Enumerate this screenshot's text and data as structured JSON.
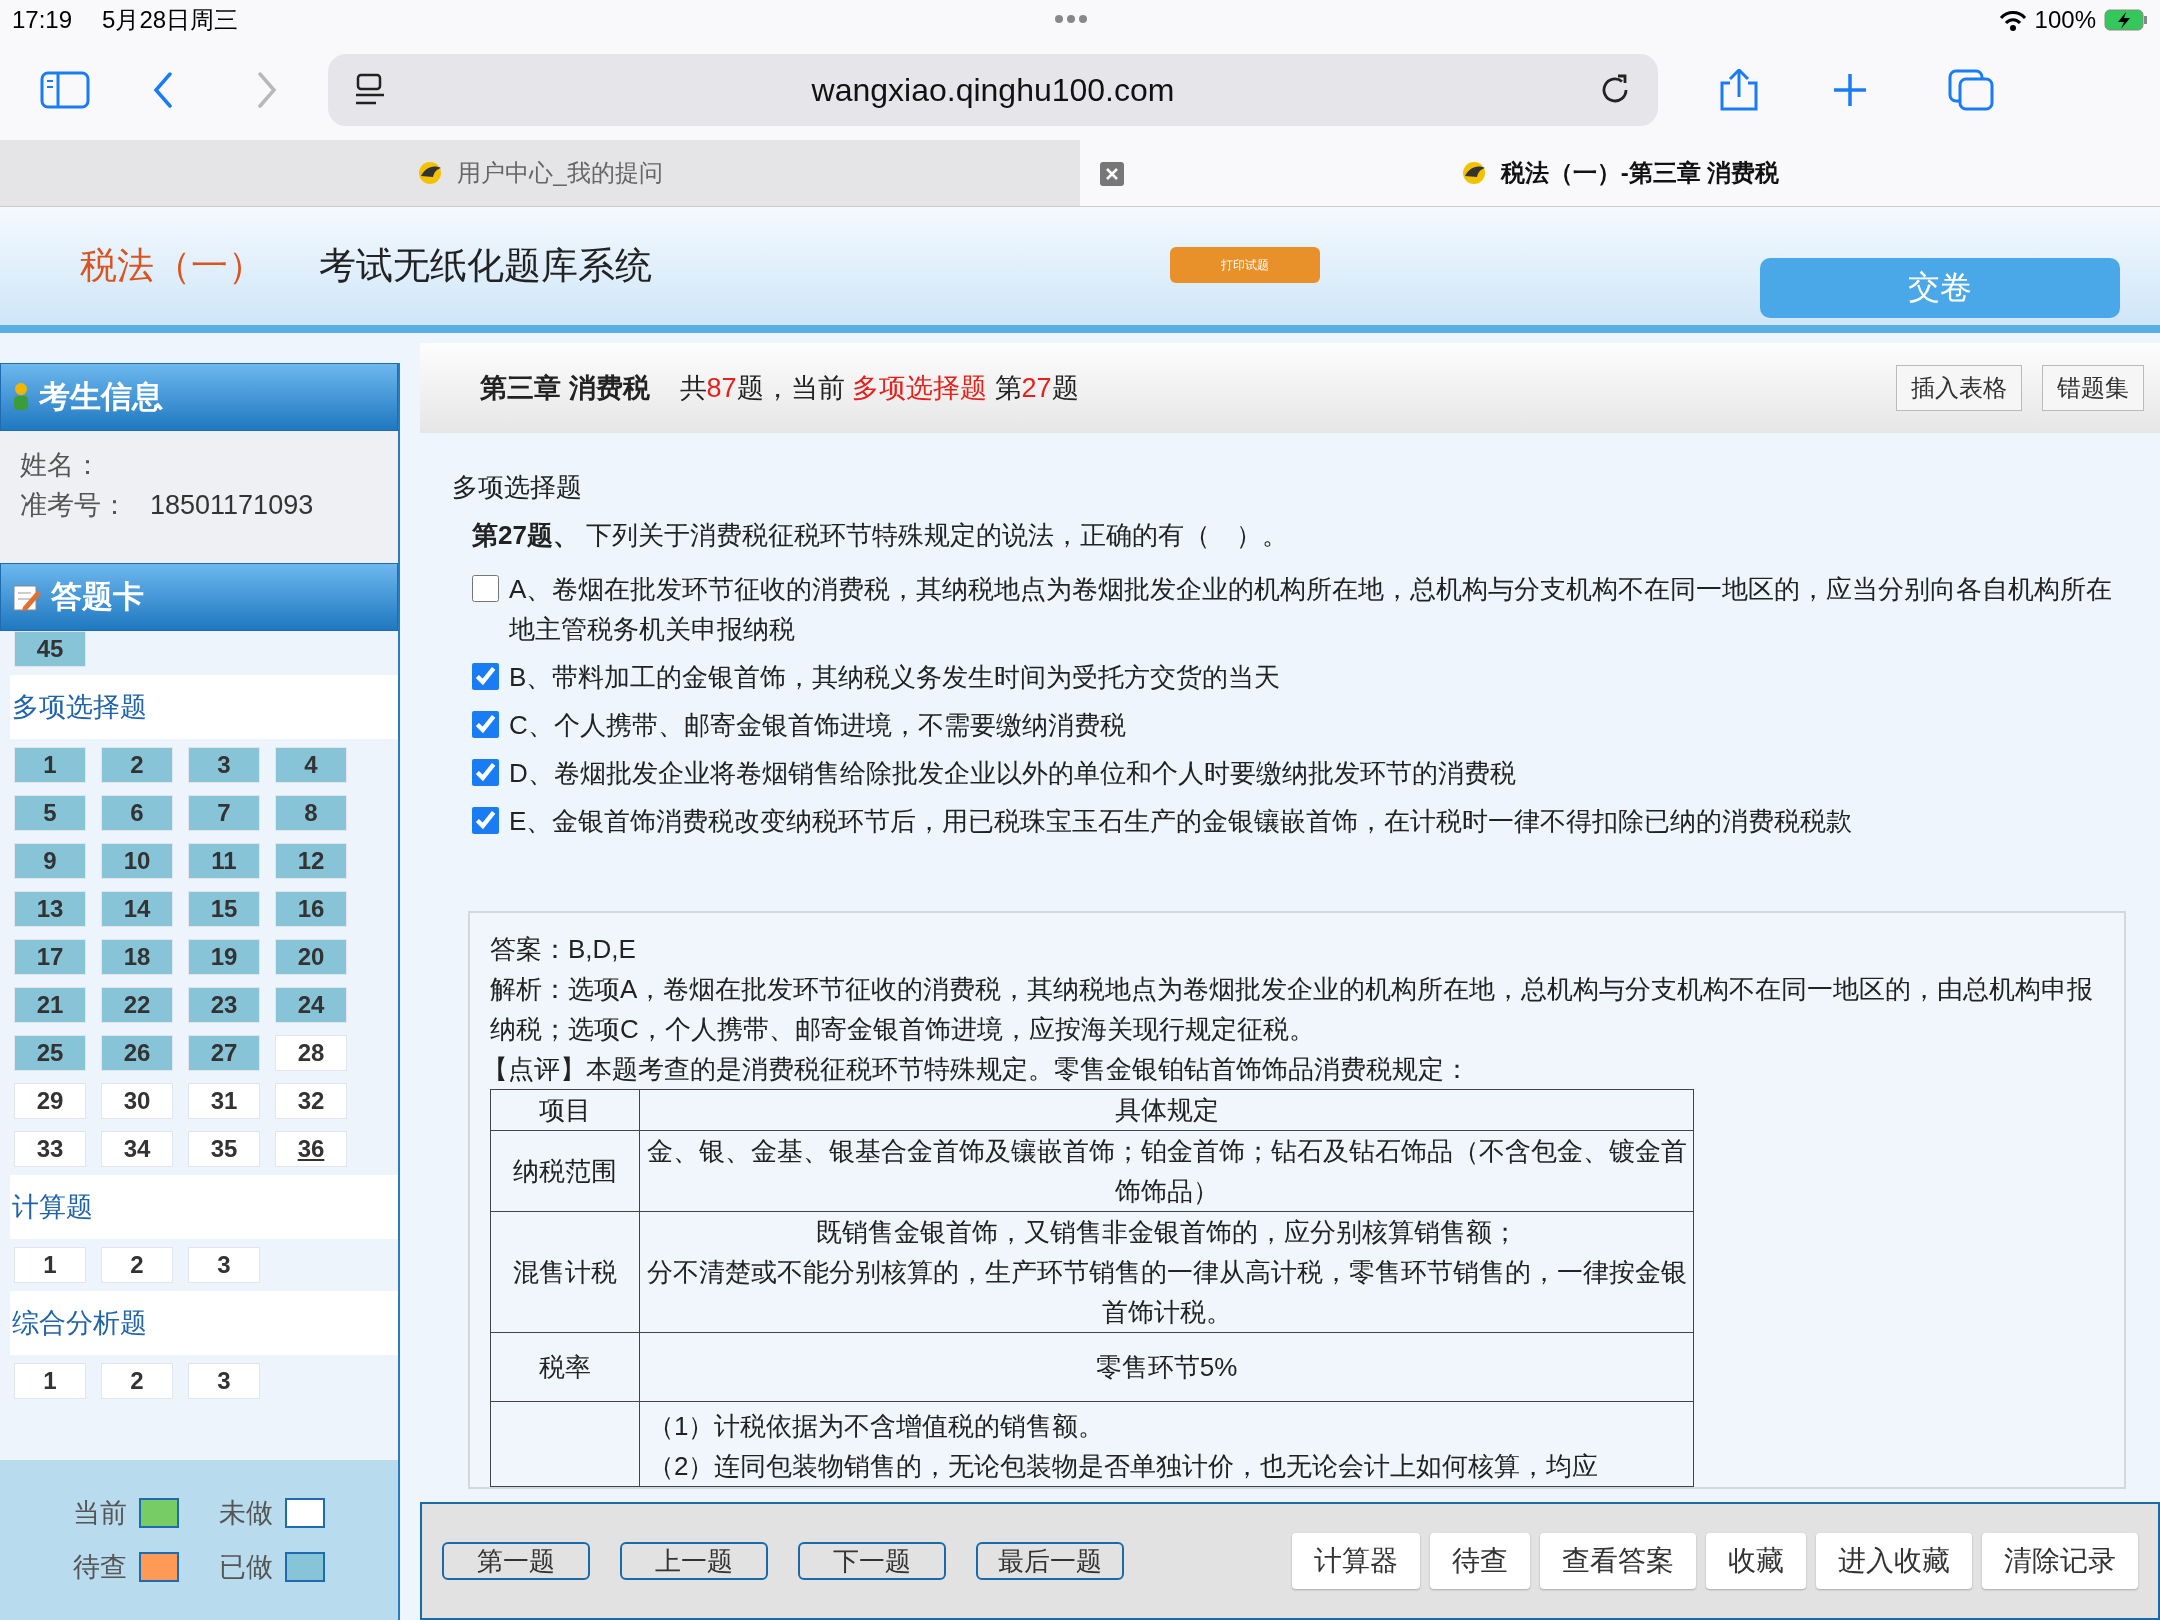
{
  "status_bar": {
    "time": "17:19",
    "date": "5月28日周三",
    "battery": "100%"
  },
  "browser": {
    "url": "wangxiao.qinghu100.com",
    "forward_disabled": true
  },
  "tabs": [
    {
      "title": "用户中心_我的提问",
      "selected": false
    },
    {
      "title": "税法（一）-第三章 消费税",
      "selected": true
    }
  ],
  "header": {
    "subject": "税法（一）",
    "system": "考试无纸化题库系统",
    "print_button": "打印试题",
    "submit_button": "交卷"
  },
  "sidebar": {
    "info_title": "考生信息",
    "fields": [
      {
        "label": "姓名："
      },
      {
        "label": "准考号：",
        "value": "18501171093"
      }
    ],
    "card_title": "答题卡",
    "sections": [
      {
        "items": [
          {
            "label": "45",
            "done": true,
            "underlined": false
          }
        ]
      },
      {
        "title": "多项选择题",
        "items": [
          {
            "label": "1",
            "done": true,
            "underlined": false
          },
          {
            "label": "2",
            "done": true,
            "underlined": false
          },
          {
            "label": "3",
            "done": true,
            "underlined": false
          },
          {
            "label": "4",
            "done": true,
            "underlined": false
          },
          {
            "label": "5",
            "done": true,
            "underlined": false
          },
          {
            "label": "6",
            "done": true,
            "underlined": false
          },
          {
            "label": "7",
            "done": true,
            "underlined": false
          },
          {
            "label": "8",
            "done": true,
            "underlined": false
          },
          {
            "label": "9",
            "done": true,
            "underlined": false
          },
          {
            "label": "10",
            "done": true,
            "underlined": false
          },
          {
            "label": "11",
            "done": true,
            "underlined": false
          },
          {
            "label": "12",
            "done": true,
            "underlined": false
          },
          {
            "label": "13",
            "done": true,
            "underlined": false
          },
          {
            "label": "14",
            "done": true,
            "underlined": false
          },
          {
            "label": "15",
            "done": true,
            "underlined": false
          },
          {
            "label": "16",
            "done": true,
            "underlined": false
          },
          {
            "label": "17",
            "done": true,
            "underlined": false
          },
          {
            "label": "18",
            "done": true,
            "underlined": false
          },
          {
            "label": "19",
            "done": true,
            "underlined": false
          },
          {
            "label": "20",
            "done": true,
            "underlined": false
          },
          {
            "label": "21",
            "done": true,
            "underlined": false
          },
          {
            "label": "22",
            "done": true,
            "underlined": false
          },
          {
            "label": "23",
            "done": true,
            "underlined": false
          },
          {
            "label": "24",
            "done": true,
            "underlined": false
          },
          {
            "label": "25",
            "done": true,
            "underlined": false
          },
          {
            "label": "26",
            "done": true,
            "underlined": false
          },
          {
            "label": "27",
            "done": true,
            "underlined": false
          },
          {
            "label": "28",
            "done": false,
            "underlined": false
          },
          {
            "label": "29",
            "done": false,
            "underlined": false
          },
          {
            "label": "30",
            "done": false,
            "underlined": false
          },
          {
            "label": "31",
            "done": false,
            "underlined": false
          },
          {
            "label": "32",
            "done": false,
            "underlined": false
          },
          {
            "label": "33",
            "done": false,
            "underlined": false
          },
          {
            "label": "34",
            "done": false,
            "underlined": false
          },
          {
            "label": "35",
            "done": false,
            "underlined": false
          },
          {
            "label": "36",
            "done": false,
            "underlined": true
          }
        ]
      },
      {
        "title": "计算题",
        "items": [
          {
            "label": "1",
            "done": false,
            "underlined": false
          },
          {
            "label": "2",
            "done": false,
            "underlined": false
          },
          {
            "label": "3",
            "done": false,
            "underlined": false
          }
        ]
      },
      {
        "title": "综合分析题",
        "items": [
          {
            "label": "1",
            "done": false,
            "underlined": false
          },
          {
            "label": "2",
            "done": false,
            "underlined": false
          },
          {
            "label": "3",
            "done": false,
            "underlined": false
          }
        ]
      }
    ],
    "legend": [
      {
        "label": "当前",
        "color": "#77cc66"
      },
      {
        "label": "未做",
        "color": "#ffffff"
      },
      {
        "label": "待查",
        "color": "#ff9955"
      },
      {
        "label": "已做",
        "color": "#88c4d8"
      }
    ]
  },
  "toolbar": {
    "chapter": "第三章 消费税",
    "progress": [
      {
        "text": "共",
        "highlight": false
      },
      {
        "text": "87",
        "highlight": true
      },
      {
        "text": "题，当前 ",
        "highlight": false
      },
      {
        "text": "多项选择题",
        "highlight": true
      },
      {
        "text": " 第",
        "highlight": false
      },
      {
        "text": "27",
        "highlight": true
      },
      {
        "text": "题",
        "highlight": false
      }
    ],
    "buttons": [
      "插入表格",
      "错题集"
    ]
  },
  "question": {
    "type": "多项选择题",
    "text": "**第27题、** 下列关于消费税征税环节特殊规定的说法，正确的有（　）。",
    "options": [
      {
        "text": "A、卷烟在批发环节征收的消费税，其纳税地点为卷烟批发企业的机构所在地，总机构与分支机构不在同一地区的，应当分别向各自机构所在地主管税务机关申报纳税",
        "checked": false
      },
      {
        "text": "B、带料加工的金银首饰，其纳税义务发生时间为受托方交货的当天",
        "checked": true
      },
      {
        "text": "C、个人携带、邮寄金银首饰进境，不需要缴纳消费税",
        "checked": true
      },
      {
        "text": "D、卷烟批发企业将卷烟销售给除批发企业以外的单位和个人时要缴纳批发环节的消费税",
        "checked": true
      },
      {
        "text": "E、金银首饰消费税改变纳税环节后，用已税珠宝玉石生产的金银镶嵌首饰，在计税时一律不得扣除已纳的消费税税款",
        "checked": true
      }
    ]
  },
  "analysis": {
    "answer": "答案：B,D,E",
    "explanation": "解析：选项A，卷烟在批发环节征收的消费税，其纳税地点为卷烟批发企业的机构所在地，总机构与分支机构不在同一地区的，由总机构申报纳税；选项C，个人携带、邮寄金银首饰进境，应按海关现行规定征税。",
    "comment": "【点评】本题考查的是消费税征税环节特殊规定。零售金银铂钻首饰饰品消费税规定：",
    "table": {
      "columns": [
        "项目",
        "具体规定"
      ],
      "rows": [
        {
          "label": "纳税范围",
          "lines": [
            "金、银、金基、银基合金首饰及镶嵌首饰；铂金首饰；钻石及钻石饰品（不含包金、镀金首饰饰品）"
          ],
          "left_aligned": false
        },
        {
          "label": "混售计税",
          "lines": [
            "既销售金银首饰，又销售非金银首饰的，应分别核算销售额；",
            "分不清楚或不能分别核算的，生产环节销售的一律从高计税，零售环节销售的，一律按金银首饰计税。"
          ],
          "left_aligned": false
        },
        {
          "label": "税率",
          "lines": [
            "零售环节5%"
          ],
          "left_aligned": false
        },
        {
          "lines": [
            "（1）计税依据为不含增值税的销售额。",
            "（2）连同包装物销售的，无论包装物是否单独计价，也无论会计上如何核算，均应"
          ],
          "left_aligned": true
        }
      ]
    }
  },
  "bottom_bar": {
    "nav_buttons": [
      "第一题",
      "上一题",
      "下一题",
      "最后一题"
    ],
    "tool_buttons": [
      "计算器",
      "待查",
      "查看答案",
      "收藏",
      "进入收藏",
      "清除记录"
    ]
  }
}
